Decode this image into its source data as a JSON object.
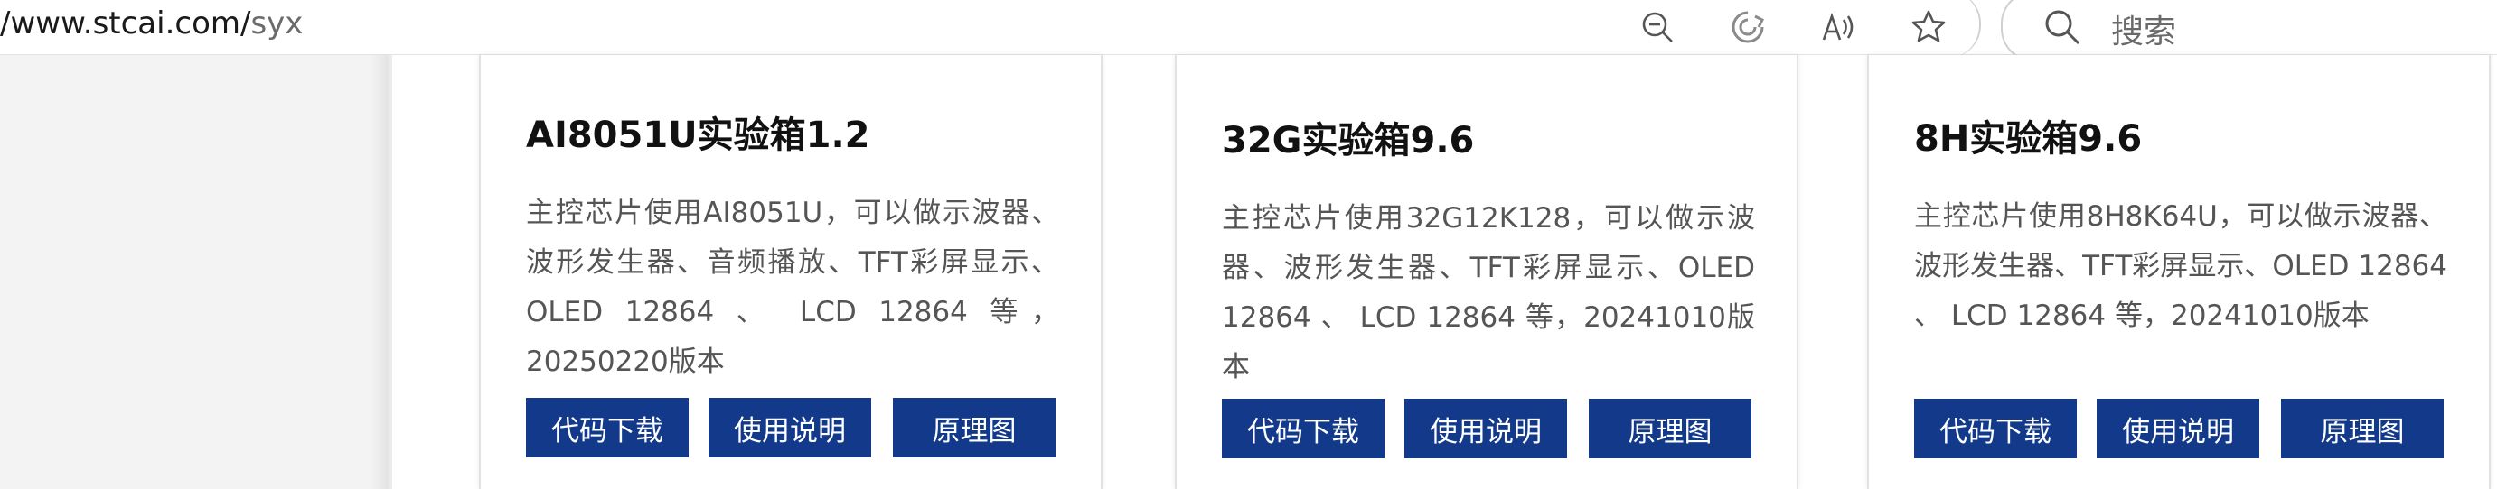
{
  "browser": {
    "url_host": "/www.stcai.com/",
    "url_path": "syx",
    "search_placeholder": "搜索",
    "icons": [
      "zoom-out-icon",
      "extension-icon",
      "read-aloud-icon",
      "favorite-star-icon",
      "search-icon"
    ]
  },
  "cards": [
    {
      "title": "AI8051U实验箱1.2",
      "description": "主控芯片使用AI8051U，可以做示波器、波形发生器、音频播放、TFT彩屏显示、OLED 12864 、 LCD 12864 等，20250220版本",
      "buttons": [
        "代码下载",
        "使用说明",
        "原理图"
      ]
    },
    {
      "title": "32G实验箱9.6",
      "description": "主控芯片使用32G12K128，可以做示波器、波形发生器、TFT彩屏显示、OLED 12864 、 LCD 12864 等，20241010版本",
      "buttons": [
        "代码下载",
        "使用说明",
        "原理图"
      ]
    },
    {
      "title": "8H实验箱9.6",
      "description": "主控芯片使用8H8K64U，可以做示波器、波形发生器、TFT彩屏显示、OLED 12864 、 LCD 12864 等，20241010版本",
      "buttons": [
        "代码下载",
        "使用说明",
        "原理图"
      ]
    }
  ],
  "colors": {
    "button_bg": "#133a8a",
    "button_text": "#ffffff",
    "title_text": "#111111",
    "desc_text": "#555555"
  }
}
